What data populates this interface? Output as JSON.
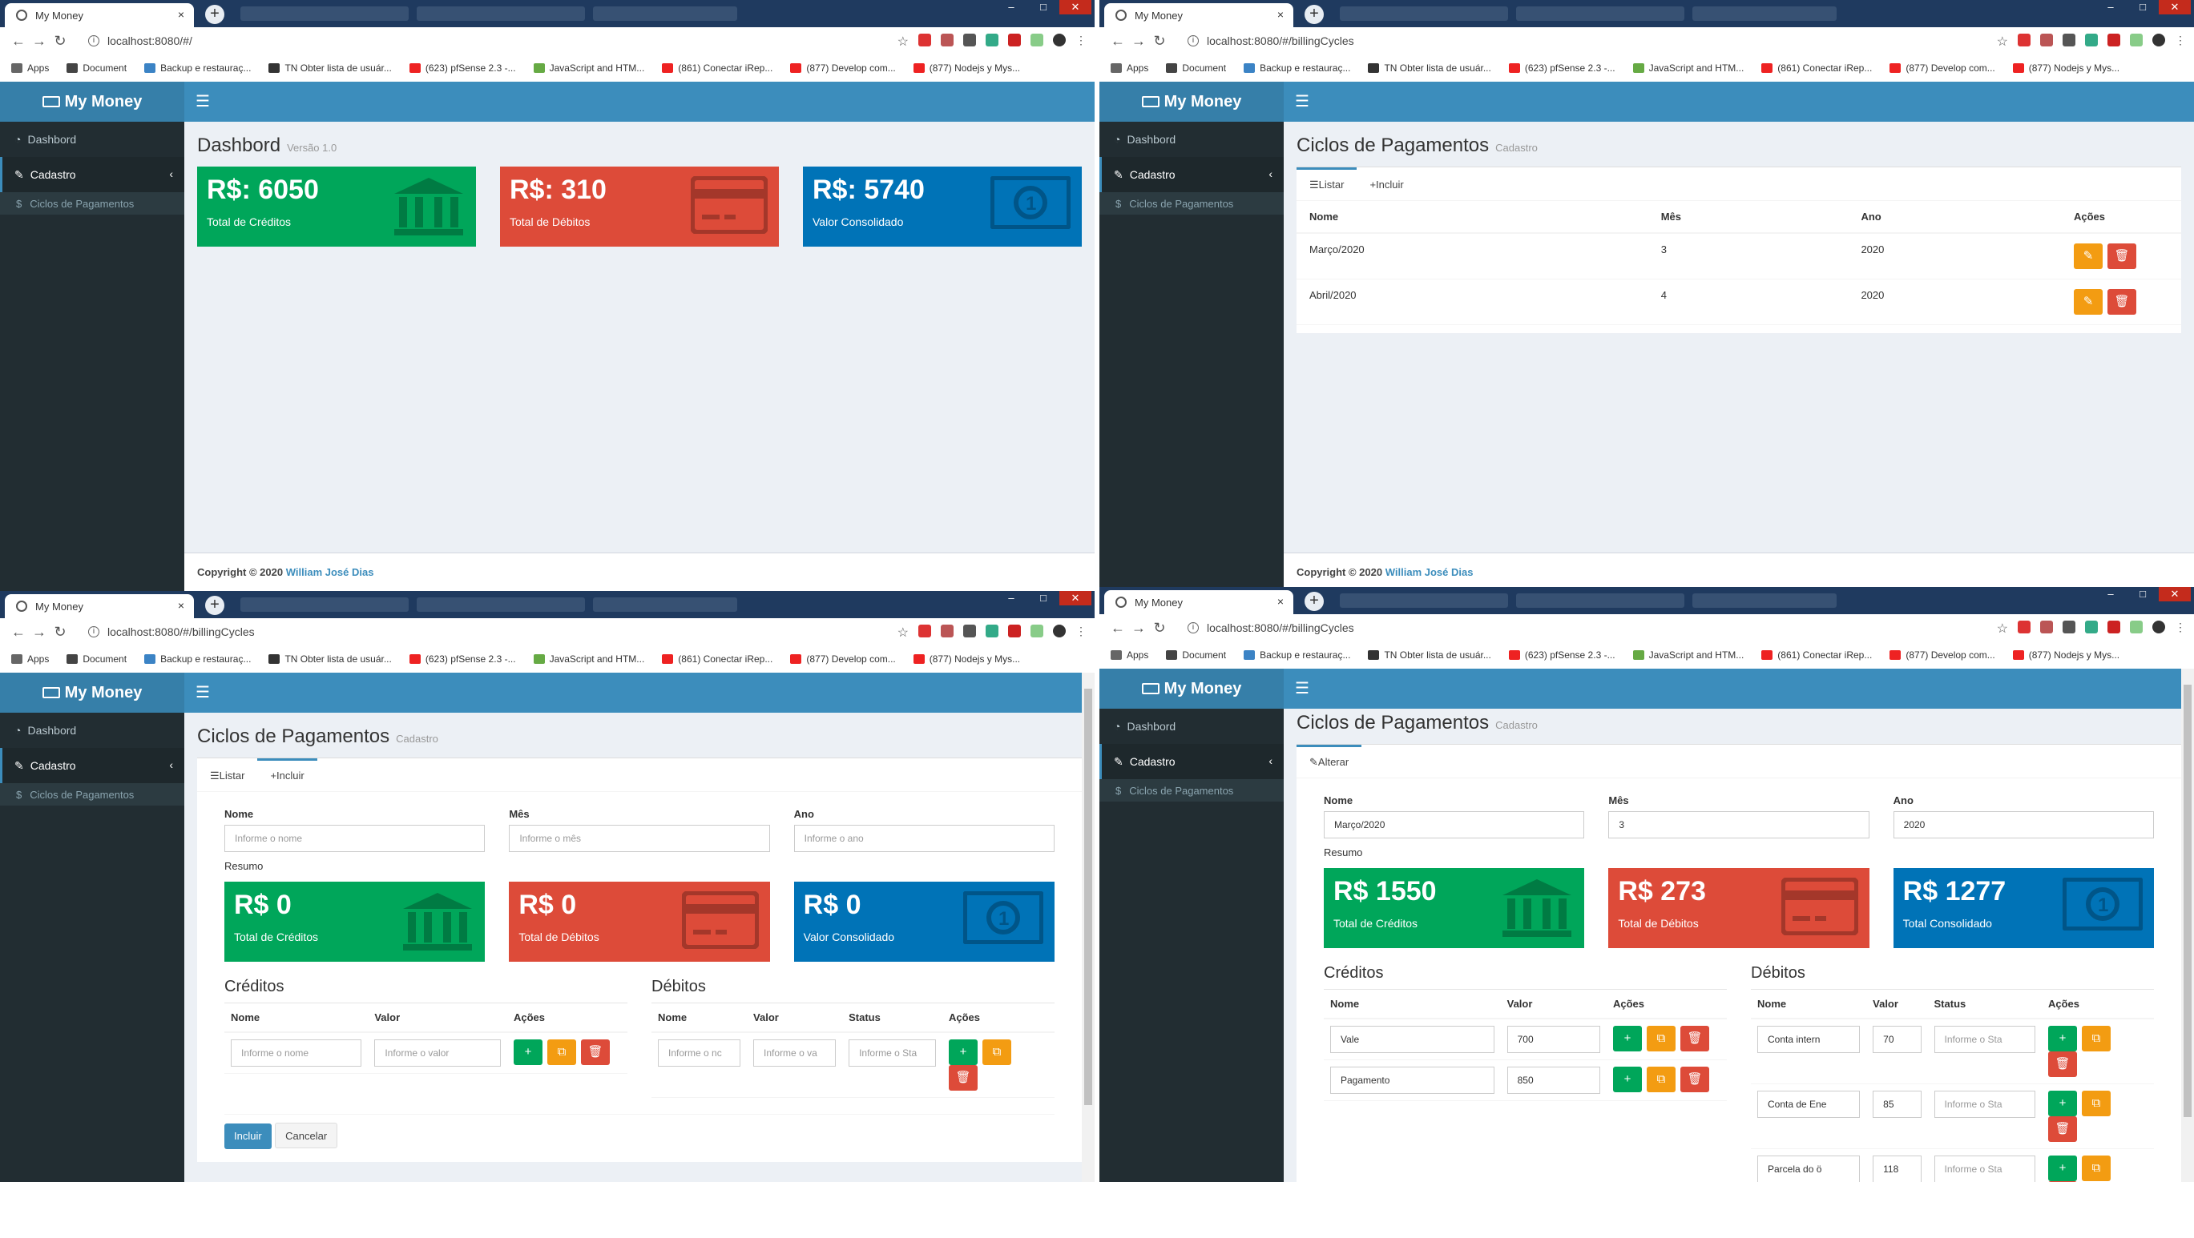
{
  "browser": {
    "tab_title": "My Money",
    "new_tab": "+",
    "close": "×",
    "bookmarks": [
      "Apps",
      "Document",
      "Backup e restauraç...",
      "TN Obter lista de usuár...",
      "(623) pfSense 2.3 -...",
      "JavaScript and HTM...",
      "(861) Conectar iRep...",
      "(877) Develop com...",
      "(877) Nodejs y Mys..."
    ],
    "colors": {
      "tabstrip": "#1f3a5f",
      "header": "#3c8dbc",
      "logo": "#367fa9",
      "sidebar": "#222d32"
    }
  },
  "app": {
    "logo": "My Money",
    "menu_icon": "☰",
    "sidebar": {
      "dashboard": "Dashbord",
      "cadastro": "Cadastro",
      "ciclos": "Ciclos de Pagamentos"
    },
    "footer": {
      "prefix": "Copyright © 2020",
      "author": "William José Dias"
    }
  },
  "q1": {
    "url": "localhost:8080/#/",
    "title": "Dashbord",
    "subtitle": "Versão 1.0",
    "boxes": [
      {
        "value": "R$: 6050",
        "label": "Total de Créditos",
        "icon": "bank-icon"
      },
      {
        "value": "R$: 310",
        "label": "Total de Débitos",
        "icon": "credit-card-icon"
      },
      {
        "value": "R$: 5740",
        "label": "Valor Consolidado",
        "icon": "money-icon"
      }
    ]
  },
  "q2": {
    "url": "localhost:8080/#/billingCycles",
    "title": "Ciclos de Pagamentos",
    "subtitle": "Cadastro",
    "tabs": [
      "Listar",
      "Incluir"
    ],
    "headers": [
      "Nome",
      "Mês",
      "Ano",
      "Ações"
    ],
    "rows": [
      {
        "nome": "Março/2020",
        "mes": "3",
        "ano": "2020"
      },
      {
        "nome": "Abril/2020",
        "mes": "4",
        "ano": "2020"
      }
    ]
  },
  "q3": {
    "url": "localhost:8080/#/billingCycles",
    "title": "Ciclos de Pagamentos",
    "subtitle": "Cadastro",
    "tabs": [
      "Listar",
      "Incluir"
    ],
    "fields": [
      {
        "label": "Nome",
        "placeholder": "Informe o nome"
      },
      {
        "label": "Mês",
        "placeholder": "Informe o mês"
      },
      {
        "label": "Ano",
        "placeholder": "Informe o ano"
      }
    ],
    "resumo": "Resumo",
    "boxes": [
      {
        "value": "R$ 0",
        "label": "Total de Créditos"
      },
      {
        "value": "R$ 0",
        "label": "Total de Débitos"
      },
      {
        "value": "R$ 0",
        "label": "Valor Consolidado"
      }
    ],
    "creditos": {
      "legend": "Créditos",
      "headers": [
        "Nome",
        "Valor",
        "Ações"
      ],
      "ph_nome": "Informe o nome",
      "ph_valor": "Informe o valor"
    },
    "debitos": {
      "legend": "Débitos",
      "headers": [
        "Nome",
        "Valor",
        "Status",
        "Ações"
      ],
      "ph_nome": "Informe o nc",
      "ph_valor": "Informe o va",
      "ph_status": "Informe o Sta"
    },
    "submit": "Incluir",
    "cancel": "Cancelar"
  },
  "q4": {
    "url": "localhost:8080/#/billingCycles",
    "title": "Ciclos de Pagamentos",
    "subtitle": "Cadastro",
    "tab": "Alterar",
    "fields": [
      {
        "label": "Nome",
        "value": "Março/2020"
      },
      {
        "label": "Mês",
        "value": "3"
      },
      {
        "label": "Ano",
        "value": "2020"
      }
    ],
    "resumo": "Resumo",
    "boxes": [
      {
        "value": "R$ 1550",
        "label": "Total de Créditos"
      },
      {
        "value": "R$ 273",
        "label": "Total de Débitos"
      },
      {
        "value": "R$ 1277",
        "label": "Total Consolidado"
      }
    ],
    "creditos": {
      "legend": "Créditos",
      "headers": [
        "Nome",
        "Valor",
        "Ações"
      ],
      "rows": [
        {
          "nome": "Vale",
          "valor": "700"
        },
        {
          "nome": "Pagamento",
          "valor": "850"
        }
      ]
    },
    "debitos": {
      "legend": "Débitos",
      "headers": [
        "Nome",
        "Valor",
        "Status",
        "Ações"
      ],
      "ph_status": "Informe o Sta",
      "rows": [
        {
          "nome": "Conta intern",
          "valor": "70"
        },
        {
          "nome": "Conta de Ene",
          "valor": "85"
        },
        {
          "nome": "Parcela do ö",
          "valor": "118"
        }
      ]
    }
  }
}
